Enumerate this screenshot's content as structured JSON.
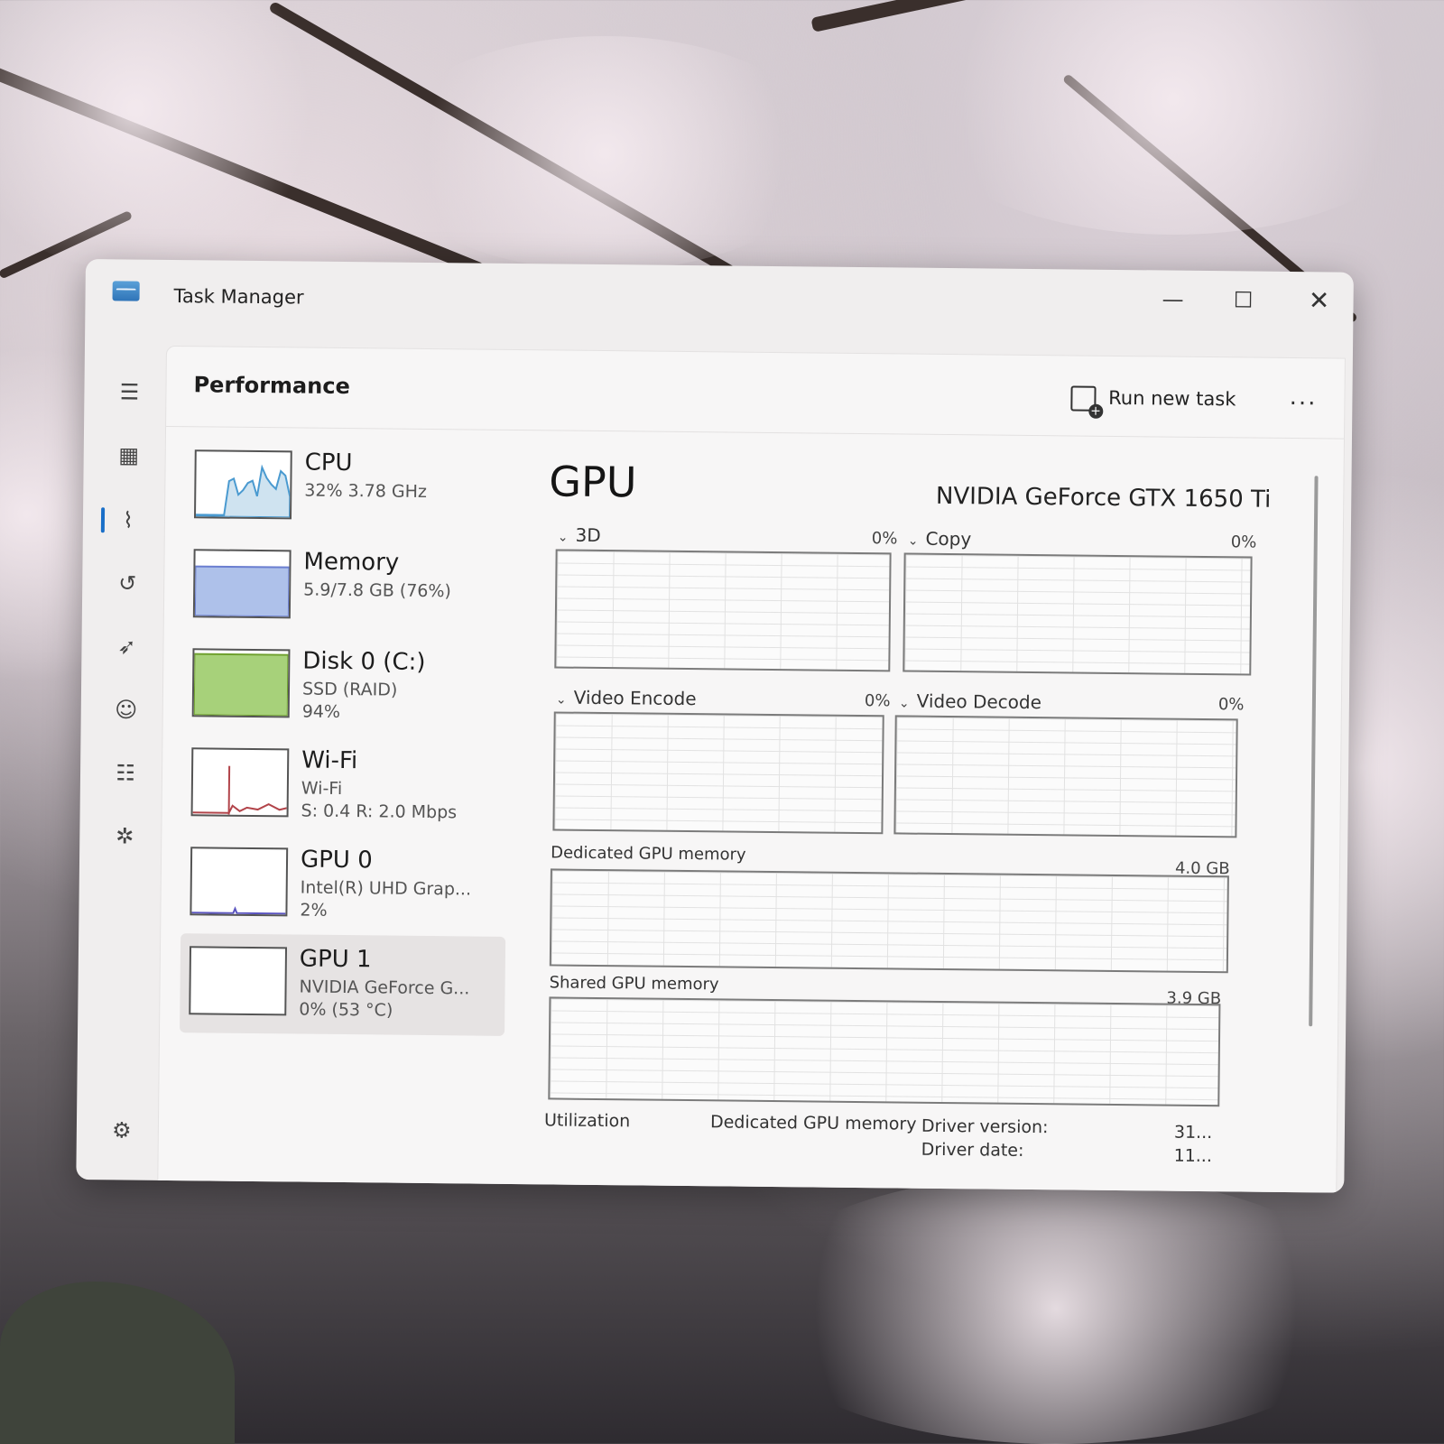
{
  "window": {
    "title": "Task Manager"
  },
  "header": {
    "title": "Performance",
    "run_task_label": "Run new task",
    "more_label": "..."
  },
  "nav_icons": [
    "menu-icon",
    "processes-icon",
    "performance-icon",
    "app-history-icon",
    "startup-apps-icon",
    "users-icon",
    "details-icon",
    "services-icon",
    "settings-icon"
  ],
  "resources": [
    {
      "name": "CPU",
      "sub1": "32% 3.78 GHz",
      "sub2": "",
      "sub3": "",
      "color": "#4a9ad0",
      "fill": "#cfe3f0",
      "selected": false
    },
    {
      "name": "Memory",
      "sub1": "5.9/7.8 GB (76%)",
      "sub2": "",
      "sub3": "",
      "color": "#6a7ed0",
      "fill": "#aec1ea",
      "level": 0.76,
      "selected": false
    },
    {
      "name": "Disk 0 (C:)",
      "sub1": "SSD (RAID)",
      "sub2": "94%",
      "sub3": "",
      "color": "#6fa02e",
      "fill": "#a7d17a",
      "level": 0.94,
      "selected": false
    },
    {
      "name": "Wi-Fi",
      "sub1": "Wi-Fi",
      "sub2": "S: 0.4 R: 2.0 Mbps",
      "sub3": "",
      "color": "#b2444a",
      "fill": "#f3d8da",
      "selected": false
    },
    {
      "name": "GPU 0",
      "sub1": "Intel(R) UHD Grap...",
      "sub2": "2%",
      "sub3": "",
      "color": "#5b55c0",
      "fill": "#d8d6f2",
      "selected": false
    },
    {
      "name": "GPU 1",
      "sub1": "NVIDIA GeForce G...",
      "sub2": "0% (53 °C)",
      "sub3": "",
      "color": "#5b55c0",
      "fill": "#d8d6f2",
      "selected": true
    }
  ],
  "main": {
    "title": "GPU",
    "model": "NVIDIA GeForce GTX 1650 Ti",
    "engines": [
      {
        "label": "3D",
        "value": "0%"
      },
      {
        "label": "Copy",
        "value": "0%"
      },
      {
        "label": "Video Encode",
        "value": "0%"
      },
      {
        "label": "Video Decode",
        "value": "0%"
      }
    ],
    "dedicated_label": "Dedicated GPU memory",
    "dedicated_value": "4.0 GB",
    "shared_label": "Shared GPU memory",
    "shared_value": "3.9 GB",
    "stats": {
      "utilization_label": "Utilization",
      "dedicated_stat_label": "Dedicated GPU memory",
      "driver_version_label": "Driver version:",
      "driver_version_value": "31...",
      "driver_date_label": "Driver date:",
      "driver_date_value": "11..."
    }
  },
  "chevron": "⌄"
}
